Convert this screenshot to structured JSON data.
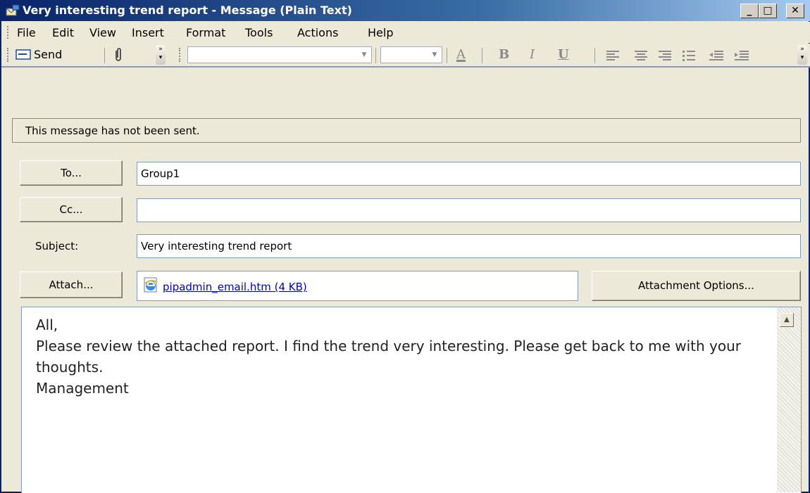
{
  "window": {
    "title": "Very interesting trend report - Message (Plain Text)",
    "controls": {
      "minimize": "_",
      "maximize": "□",
      "close": "✕"
    }
  },
  "menu": [
    {
      "label": "File"
    },
    {
      "label": "Edit"
    },
    {
      "label": "View"
    },
    {
      "label": "Insert"
    },
    {
      "label": "Format"
    },
    {
      "label": "Tools"
    },
    {
      "label": "Actions"
    },
    {
      "label": "Help"
    }
  ],
  "toolbar": {
    "send_label": "Send",
    "font_name": "",
    "font_size": "",
    "format_buttons": {
      "font_color": "A",
      "bold": "B",
      "italic": "I",
      "underline": "U"
    }
  },
  "infobar": {
    "text": "This message has not been sent."
  },
  "header": {
    "to_button": "To...",
    "to_value": "Group1",
    "cc_button": "Cc...",
    "cc_value": "",
    "subject_label": "Subject:",
    "subject_value": "Very interesting trend report",
    "attach_button": "Attach...",
    "attachment_name": "pipadmin_email.htm (4 KB)",
    "attachment_options_button": "Attachment Options..."
  },
  "body": {
    "lines": [
      "All,",
      "",
      "Please review the attached report. I find the trend very interesting. Please get back to me with your thoughts.",
      "",
      "Management"
    ]
  },
  "colors": {
    "title_bar": "#0a246a",
    "link": "#0000cc",
    "chrome": "#ece9d8"
  }
}
